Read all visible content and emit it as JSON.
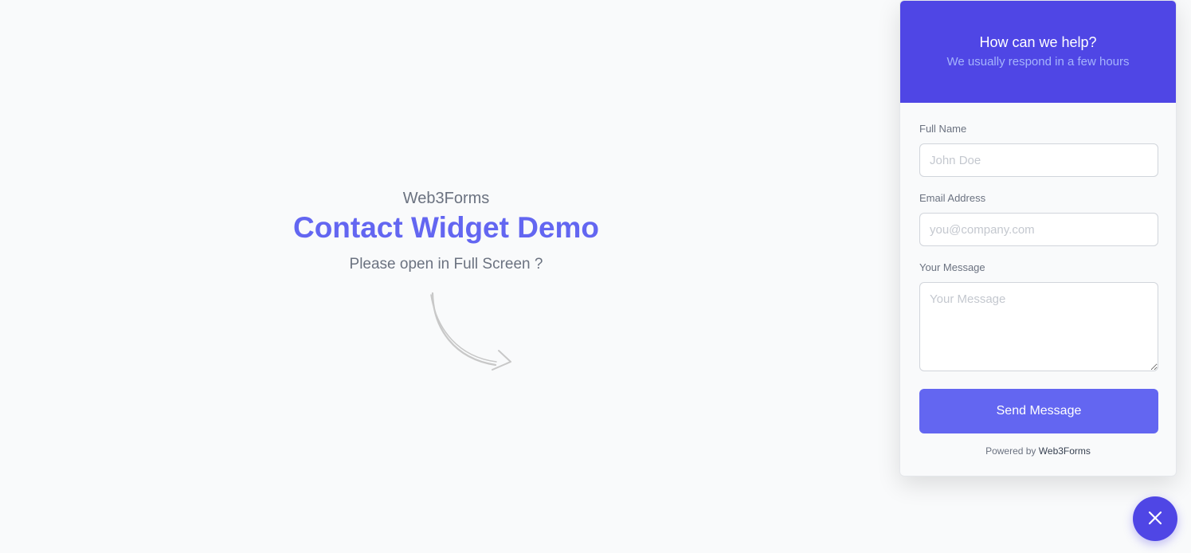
{
  "hero": {
    "brand": "Web3Forms",
    "title": "Contact Widget Demo",
    "subtitle": "Please open in Full Screen ?"
  },
  "widget": {
    "title": "How can we help?",
    "subtitle": "We usually respond in a few hours",
    "fields": {
      "name": {
        "label": "Full Name",
        "placeholder": "John Doe",
        "value": ""
      },
      "email": {
        "label": "Email Address",
        "placeholder": "you@company.com",
        "value": ""
      },
      "message": {
        "label": "Your Message",
        "placeholder": "Your Message",
        "value": ""
      }
    },
    "send_label": "Send Message",
    "powered_prefix": "Powered by",
    "powered_link": "Web3Forms"
  },
  "icons": {
    "arrow": "curved-arrow-icon",
    "close": "close-icon"
  },
  "colors": {
    "accent": "#4f46e5",
    "button": "#6366f1",
    "title": "#6366f1",
    "background": "#f9fafb"
  }
}
